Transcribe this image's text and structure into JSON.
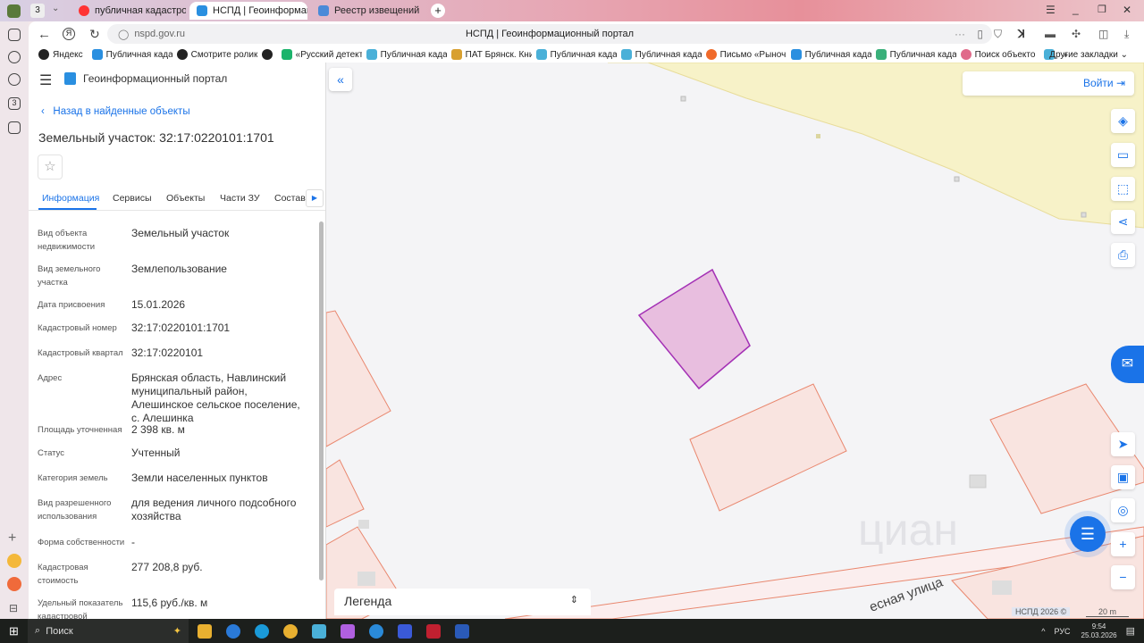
{
  "browser": {
    "tab_count": "3",
    "tabs": [
      {
        "label": "публичная кадастровая"
      },
      {
        "label": "НСПД | Геоинформаци"
      },
      {
        "label": "Реестр извещений"
      }
    ],
    "url": "nspd.gov.ru",
    "page_title": "НСПД | Геоинформационный портал",
    "bookmarks": [
      "Яндекс",
      "Публичная кадас",
      "Смотрите ролики",
      "",
      "«Русский детекти",
      "Публичная кадас",
      "ПАТ Брянск. Кни",
      "Публичная кадас",
      "Публичная кадас",
      "Письмо «Рыночн",
      "Публичная кадас",
      "Публичная кадас",
      "Поиск объекто",
      ""
    ],
    "more": "»",
    "other_bookmarks": "Другие закладки"
  },
  "app": {
    "title": "Геоинформационный портал",
    "back_link": "Назад в найденные объекты",
    "object_title": "Земельный участок: 32:17:0220101:1701",
    "tabs": [
      "Информация",
      "Сервисы",
      "Объекты",
      "Части ЗУ",
      "Состав"
    ],
    "fields": [
      {
        "label": "Вид объекта недвижимости",
        "value": "Земельный участок"
      },
      {
        "label": "Вид земельного участка",
        "value": "Землепользование"
      },
      {
        "label": "Дата присвоения",
        "value": "15.01.2026"
      },
      {
        "label": "Кадастровый номер",
        "value": "32:17:0220101:1701"
      },
      {
        "label": "Кадастровый квартал",
        "value": "32:17:0220101"
      },
      {
        "label": "Адрес",
        "value": "Брянская область, Навлинский муниципальный район, Алешинское сельское поселение, с. Алешинка"
      },
      {
        "label": "Площадь уточненная",
        "value": "2 398 кв. м"
      },
      {
        "label": "Статус",
        "value": "Учтенный"
      },
      {
        "label": "Категория земель",
        "value": "Земли населенных пунктов"
      },
      {
        "label": "Вид разрешенного использования",
        "value": "для ведения личного подсобного хозяйства"
      },
      {
        "label": "Форма собственности",
        "value": "-"
      },
      {
        "label": "Кадастровая стоимость",
        "value": "277 208,8 руб."
      },
      {
        "label": "Удельный показатель кадастровой",
        "value": "115,6 руб./кв. м"
      }
    ]
  },
  "map": {
    "login": "Войти",
    "legend": "Легенда",
    "street": "есная улица",
    "copyright": "НСПД 2026 ©",
    "scale": "20 m",
    "watermark": "циан"
  },
  "taskbar": {
    "search": "Поиск",
    "lang": "РУС",
    "time": "9:54",
    "date": "25.03.2026"
  }
}
